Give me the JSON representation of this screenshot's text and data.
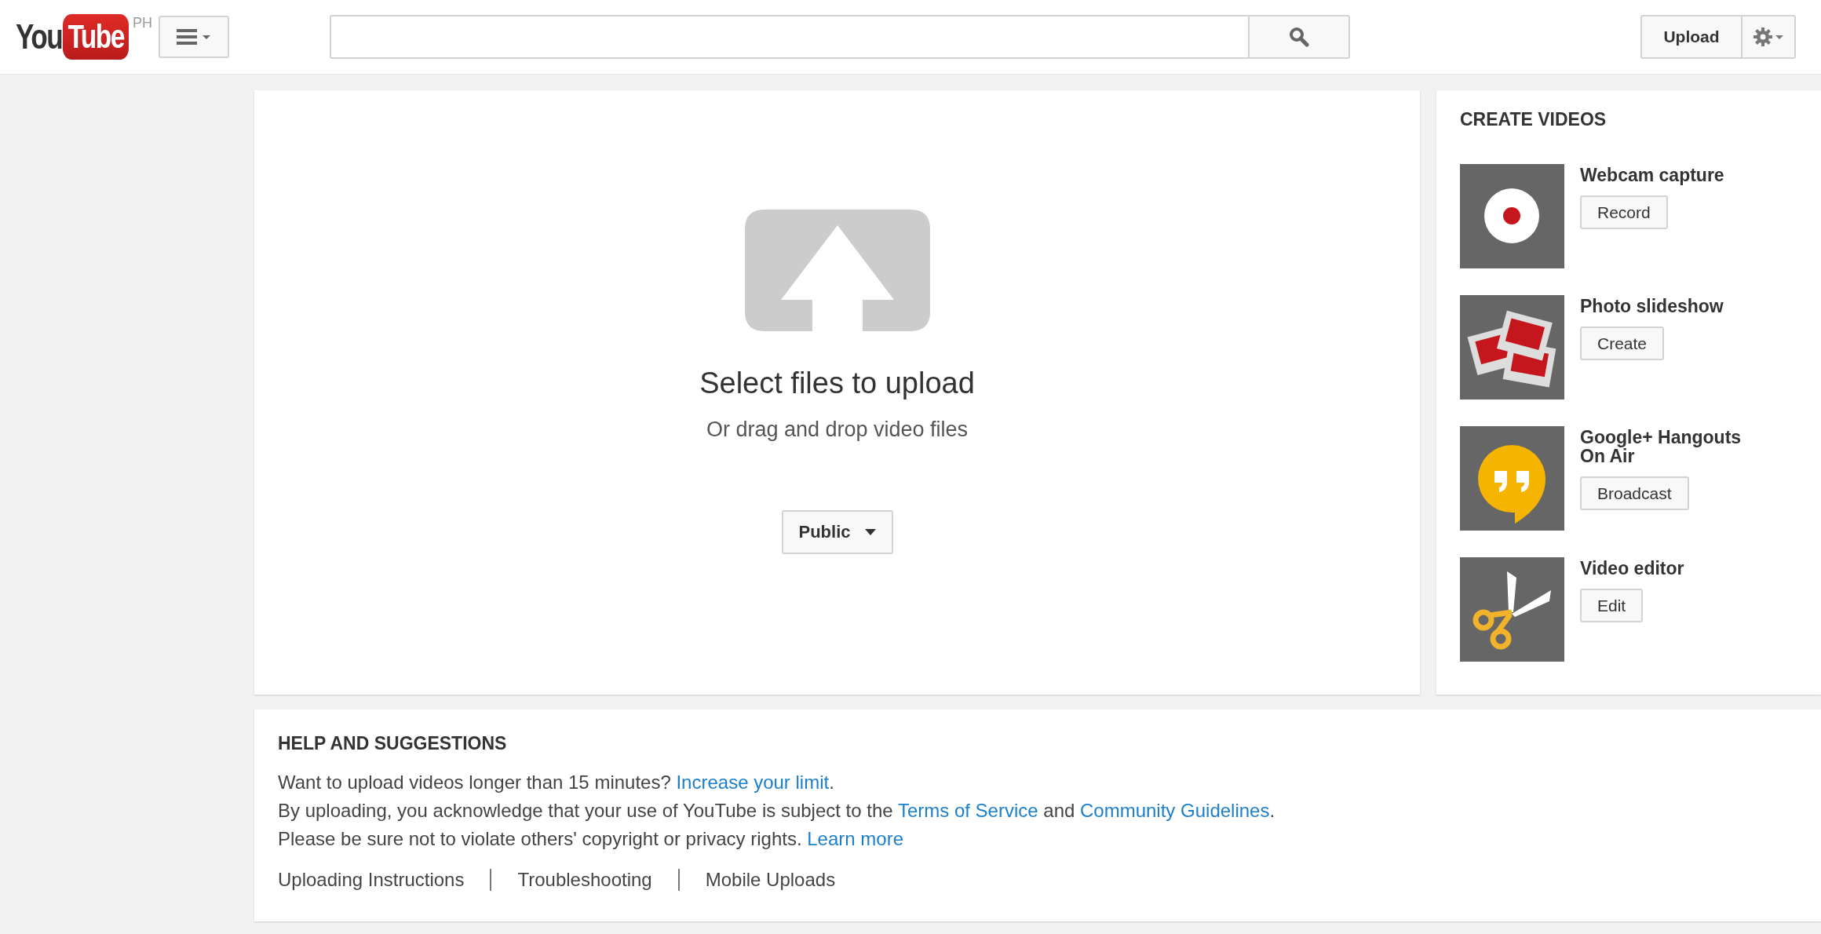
{
  "header": {
    "logo": {
      "left": "You",
      "right": "Tube",
      "region": "PH"
    },
    "upload_button": "Upload"
  },
  "upload": {
    "title": "Select files to upload",
    "subtitle": "Or drag and drop video files",
    "privacy": "Public"
  },
  "create_videos": {
    "heading": "CREATE VIDEOS",
    "items": [
      {
        "kind": "webcam",
        "title": "Webcam capture",
        "button": "Record"
      },
      {
        "kind": "slideshow",
        "title": "Photo slideshow",
        "button": "Create"
      },
      {
        "kind": "hangout",
        "title": "Google+ Hangouts On Air",
        "button": "Broadcast"
      },
      {
        "kind": "editor",
        "title": "Video editor",
        "button": "Edit"
      }
    ]
  },
  "help": {
    "heading": "HELP AND SUGGESTIONS",
    "lines": [
      [
        {
          "kind": "text",
          "text": "Want to upload videos longer than 15 minutes? "
        },
        {
          "kind": "link",
          "text": "Increase your limit"
        },
        {
          "kind": "text",
          "text": "."
        }
      ],
      [
        {
          "kind": "text",
          "text": "By uploading, you acknowledge that your use of YouTube is subject to the "
        },
        {
          "kind": "link",
          "text": "Terms of Service"
        },
        {
          "kind": "text",
          "text": " and "
        },
        {
          "kind": "link",
          "text": "Community Guidelines"
        },
        {
          "kind": "text",
          "text": "."
        }
      ],
      [
        {
          "kind": "text",
          "text": "Please be sure not to violate others' copyright or privacy rights. "
        },
        {
          "kind": "link",
          "text": "Learn more"
        }
      ]
    ],
    "footer_links": [
      "Uploading Instructions",
      "Troubleshooting",
      "Mobile Uploads"
    ]
  }
}
